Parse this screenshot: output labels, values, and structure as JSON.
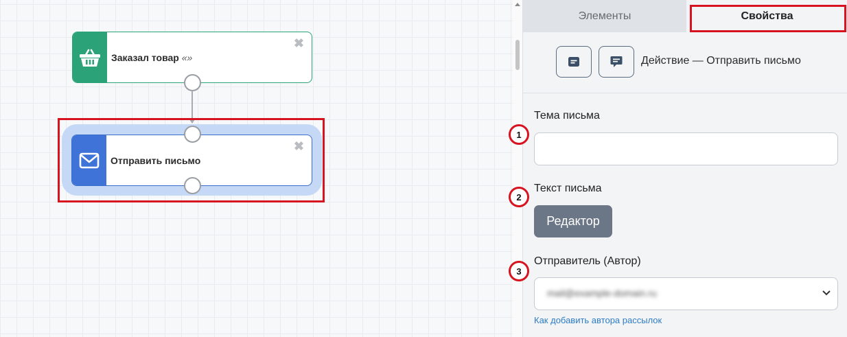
{
  "canvas": {
    "nodes": [
      {
        "title": "Заказал товар",
        "quote": "«»",
        "icon": "basket-icon",
        "color": "#2ca279"
      },
      {
        "title": "Отправить письмо",
        "icon": "envelope-icon",
        "color": "#3f73d8"
      }
    ]
  },
  "panel": {
    "tabs": [
      "Элементы",
      "Свойства"
    ],
    "action_label": "Действие — Отправить письмо",
    "fields": {
      "subject_label": "Тема письма",
      "subject_value": "",
      "body_label": "Текст письма",
      "editor_button": "Редактор",
      "sender_label": "Отправитель (Автор)",
      "sender_value": "mail@example-domain.ru",
      "help_link": "Как добавить автора рассылок"
    },
    "badges": [
      "1",
      "2",
      "3"
    ]
  },
  "colors": {
    "highlight": "#d7131f",
    "trigger": "#2ca279",
    "action": "#3f73d8",
    "link": "#2d7cc4"
  }
}
